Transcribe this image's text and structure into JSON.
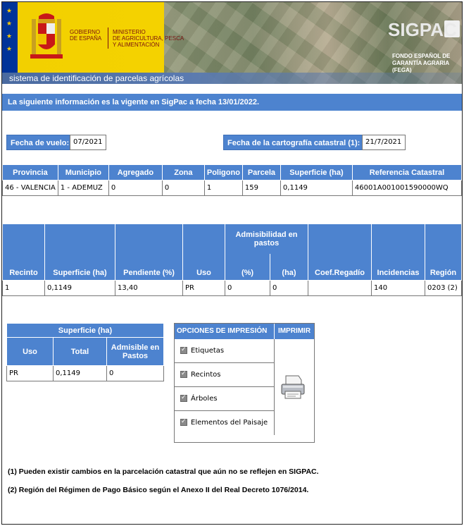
{
  "header": {
    "gobierno": [
      "GOBIERNO",
      "DE ESPAÑA"
    ],
    "ministerio": [
      "MINISTERIO",
      "DE AGRICULTURA, PESCA",
      "Y ALIMENTACIÓN"
    ],
    "sigpac": "SIGPAC",
    "fega": [
      "FONDO ESPAÑOL DE",
      "GARANTÍA AGRARIA",
      "(FEGA)"
    ],
    "subtitle": "sistema de identificación de parcelas agrícolas"
  },
  "info": "La siguiente información es la vigente en SigPac a fecha 13/01/2022.",
  "vuelo": {
    "label": "Fecha de vuelo:",
    "value": "07/2021"
  },
  "cartografia": {
    "label": "Fecha de la cartografía catastral (1):",
    "value": "21/7/2021"
  },
  "parcela_table": {
    "headers": [
      "Provincia",
      "Municipio",
      "Agregado",
      "Zona",
      "Poligono",
      "Parcela",
      "Superficie (ha)",
      "Referencia Catastral"
    ],
    "row": [
      "46 - VALENCIA",
      "1 - ADEMUZ",
      "0",
      "0",
      "1",
      "159",
      "0,1149",
      "46001A001001590000WQ"
    ]
  },
  "recinto_table": {
    "group_header": "Admisibilidad en pastos",
    "headers": [
      "Recinto",
      "Superficie (ha)",
      "Pendiente (%)",
      "Uso",
      "(%)",
      "(ha)",
      "Coef.Regadío",
      "Incidencias",
      "Región"
    ],
    "row": [
      "1",
      "0,1149",
      "13,40",
      "PR",
      "0",
      "0",
      "",
      "140",
      "0203 (2)"
    ]
  },
  "superficie_table": {
    "title": "Superficie (ha)",
    "headers": [
      "Uso",
      "Total",
      "Admisible en Pastos"
    ],
    "row": [
      "PR",
      "0,1149",
      "0"
    ]
  },
  "print_options": {
    "title": "OPCIONES DE IMPRESIÓN",
    "print_label": "IMPRIMIR",
    "options": [
      "Etiquetas",
      "Recintos",
      "Árboles",
      "Elementos del Paisaje"
    ]
  },
  "notes": [
    "(1) Pueden existir cambios en la parcelación catastral que aún no se reflejen en SIGPAC.",
    "(2) Región del Régimen de Pago Básico según el Anexo II del Real Decreto 1076/2014."
  ],
  "colors": {
    "header_blue": "#4d83cf",
    "banner_yellow": "#f4d200"
  }
}
